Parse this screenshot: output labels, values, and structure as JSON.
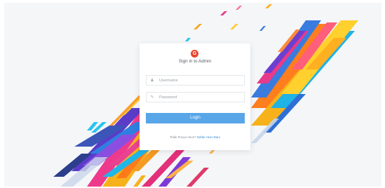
{
  "login": {
    "logo_glyph": "G",
    "title": "Sign in to Admin",
    "username": {
      "icon": "user-icon",
      "placeholder": "Username",
      "value": ""
    },
    "password": {
      "icon": "key-icon",
      "placeholder": "Password",
      "value": ""
    },
    "login_button": "Login",
    "signup_prompt": "Tidak Punya Akun?",
    "signup_link": "Daftar Akun Baru"
  },
  "colors": {
    "accent": "#58a6e8",
    "logo": "#e8452c",
    "background": "#f4f6f8",
    "link": "#3d8fd6"
  }
}
